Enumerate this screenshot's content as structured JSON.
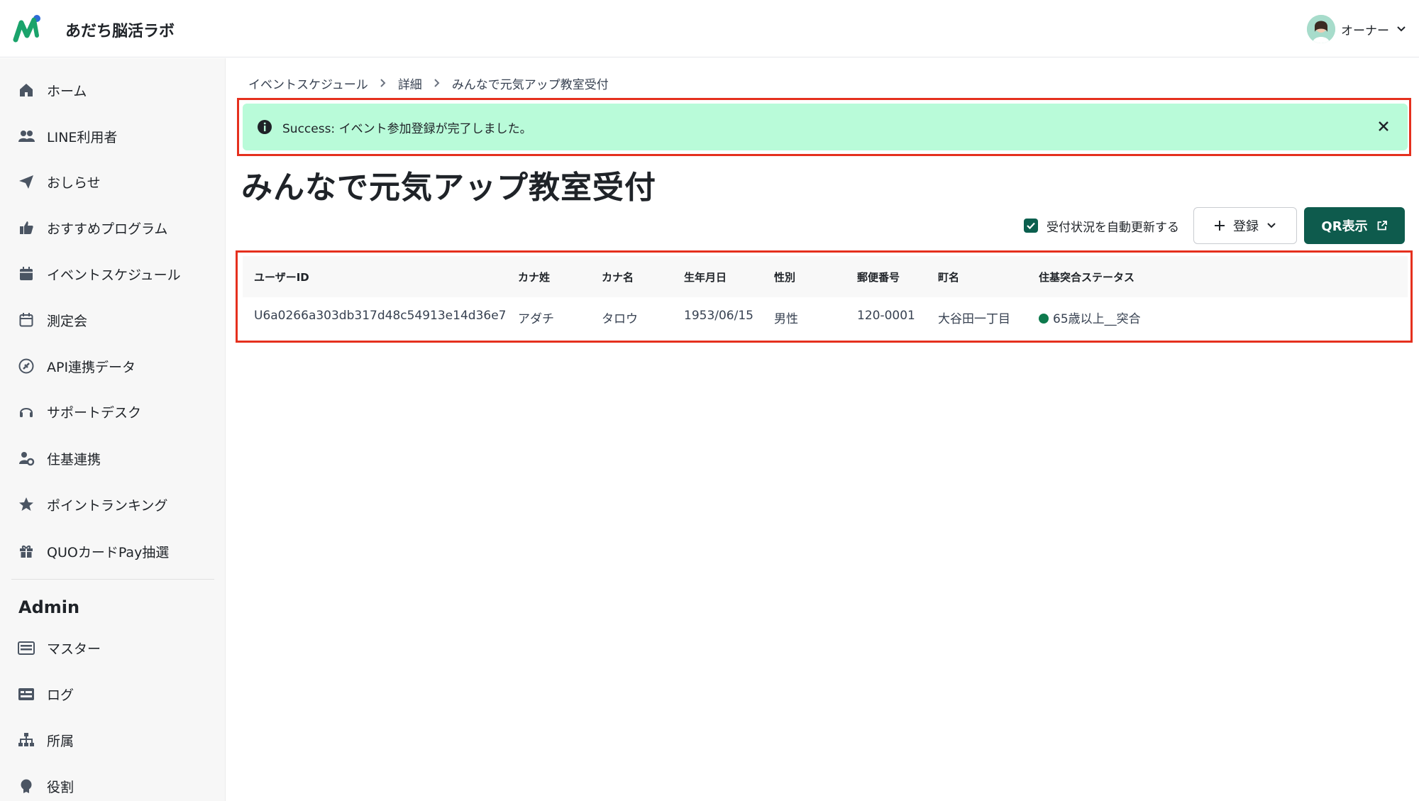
{
  "header": {
    "app_name": "あだち脳活ラボ",
    "user_name": "オーナー",
    "logo_icon": "app-logo",
    "colors": {
      "logo_green": "#1aa36b",
      "logo_blue": "#2d6bd6"
    }
  },
  "sidebar": {
    "items": [
      {
        "label": "ホーム",
        "icon": "home-icon"
      },
      {
        "label": "LINE利用者",
        "icon": "users-icon"
      },
      {
        "label": "おしらせ",
        "icon": "paper-plane-icon"
      },
      {
        "label": "おすすめプログラム",
        "icon": "thumbs-up-icon"
      },
      {
        "label": "イベントスケジュール",
        "icon": "calendar-filled-icon"
      },
      {
        "label": "測定会",
        "icon": "calendar-outline-icon"
      },
      {
        "label": "API連携データ",
        "icon": "plug-circle-icon"
      },
      {
        "label": "サポートデスク",
        "icon": "headset-icon"
      },
      {
        "label": "住基連携",
        "icon": "user-gear-icon"
      },
      {
        "label": "ポイントランキング",
        "icon": "star-icon"
      },
      {
        "label": "QUOカードPay抽選",
        "icon": "gift-icon"
      }
    ],
    "admin_title": "Admin",
    "admin_items": [
      {
        "label": "マスター",
        "icon": "list-box-icon"
      },
      {
        "label": "ログ",
        "icon": "log-box-icon"
      },
      {
        "label": "所属",
        "icon": "org-tree-icon"
      },
      {
        "label": "役割",
        "icon": "badge-icon"
      }
    ]
  },
  "breadcrumb": [
    "イベントスケジュール",
    "詳細",
    "みんなで元気アップ教室受付"
  ],
  "alert": {
    "prefix": "Success:",
    "message": "イベント参加登録が完了しました。",
    "color": "#b9fbd9"
  },
  "page_title": "みんなで元気アップ教室受付",
  "toolbar": {
    "auto_update_label": "受付状況を自動更新する",
    "auto_update_checked": true,
    "register_label": "登録",
    "qr_label": "QR表示",
    "qr_color": "#0e5b4d"
  },
  "table": {
    "headers": [
      "ユーザーID",
      "カナ姓",
      "カナ名",
      "生年月日",
      "性別",
      "郵便番号",
      "町名",
      "住基突合ステータス"
    ],
    "rows": [
      [
        "U6a0266a303db317d48c54913e14d36e7",
        "アダチ",
        "タロウ",
        "1953/06/15",
        "男性",
        "120-0001",
        "大谷田一丁目",
        "65歳以上__突合"
      ]
    ],
    "status_color": "#0e7a4d"
  },
  "highlight_color": "#e5301e"
}
